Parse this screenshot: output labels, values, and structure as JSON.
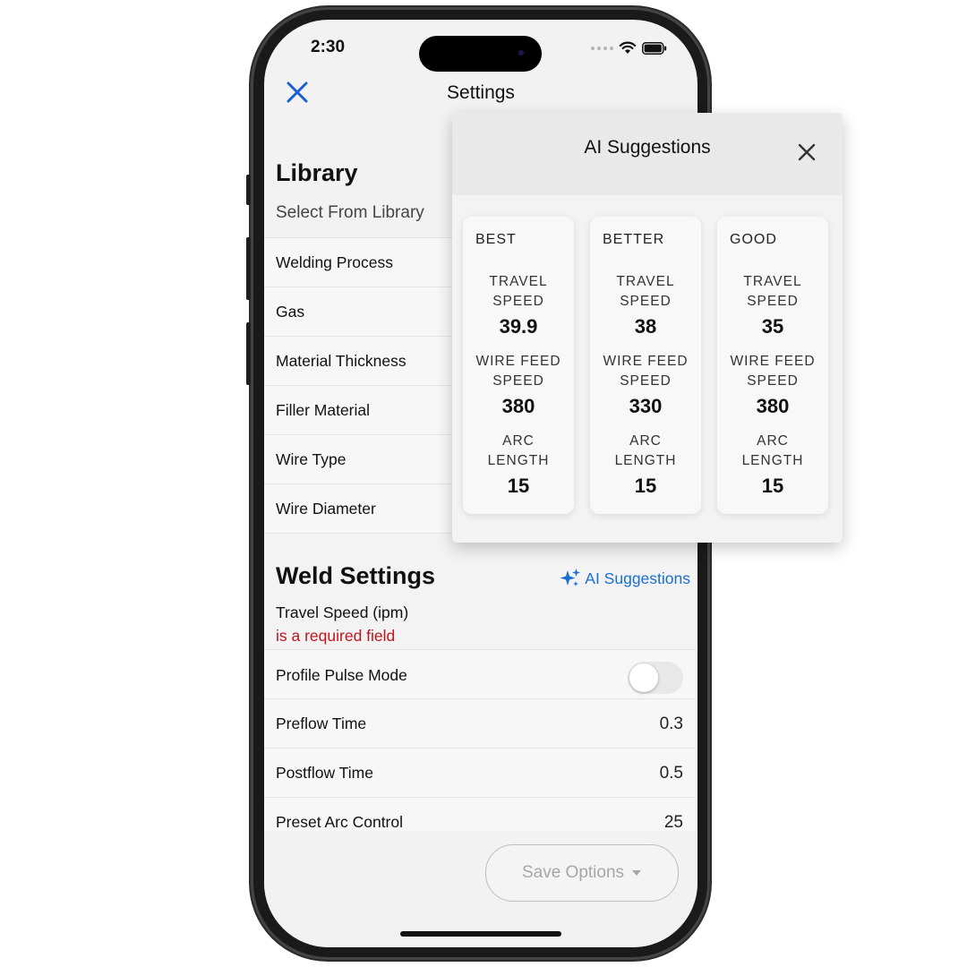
{
  "status": {
    "time": "2:30"
  },
  "nav": {
    "title": "Settings"
  },
  "library": {
    "heading": "Library",
    "select_label": "Select From Library"
  },
  "library_fields": [
    {
      "label": "Welding Process"
    },
    {
      "label": "Gas"
    },
    {
      "label": "Material Thickness"
    },
    {
      "label": "Filler Material"
    },
    {
      "label": "Wire Type"
    },
    {
      "label": "Wire Diameter"
    }
  ],
  "weld": {
    "heading": "Weld Settings",
    "ai_link": "AI Suggestions",
    "travel_label": "Travel Speed (ipm)",
    "travel_error": "is a required field",
    "pulse_label": "Profile Pulse Mode",
    "pulse_on": false,
    "preflow_label": "Preflow Time",
    "preflow_value": "0.3",
    "postflow_label": "Postflow Time",
    "postflow_value": "0.5",
    "arc_label": "Preset Arc Control",
    "arc_value": "25"
  },
  "save": {
    "label": "Save Options"
  },
  "popover": {
    "title": "AI Suggestions",
    "metric_labels": {
      "travel_1": "TRAVEL",
      "travel_2": "SPEED",
      "wire_1": "WIRE FEED",
      "wire_2": "SPEED",
      "arc_1": "ARC",
      "arc_2": "LENGTH"
    },
    "cards": [
      {
        "tier": "BEST",
        "travel": "39.9",
        "wire": "380",
        "arc": "15"
      },
      {
        "tier": "BETTER",
        "travel": "38",
        "wire": "330",
        "arc": "15"
      },
      {
        "tier": "GOOD",
        "travel": "35",
        "wire": "380",
        "arc": "15"
      }
    ]
  },
  "colors": {
    "accent": "#1a6fd1",
    "error": "#c0141c"
  },
  "icons": {
    "close": "close-icon",
    "wifi": "wifi-icon",
    "battery": "battery-icon",
    "sparkle": "sparkle-icon",
    "caret": "caret-down-icon"
  }
}
